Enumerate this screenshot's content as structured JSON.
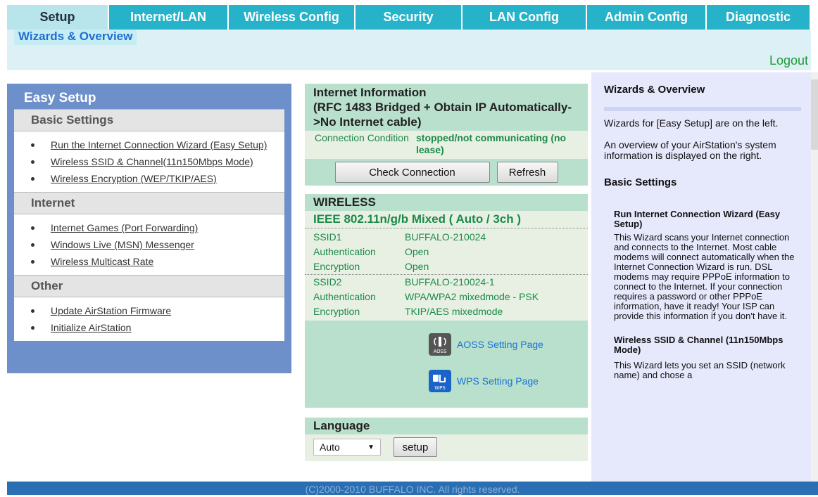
{
  "tabs": [
    "Setup",
    "Internet/LAN",
    "Wireless Config",
    "Security",
    "LAN Config",
    "Admin Config",
    "Diagnostic"
  ],
  "subtab": "Wizards & Overview",
  "logout": "Logout",
  "left": {
    "title": "Easy Setup",
    "sections": [
      {
        "name": "Basic Settings",
        "items": [
          "Run the Internet Connection Wizard (Easy Setup)",
          "Wireless SSID & Channel(11n150Mbps Mode)",
          "Wireless Encryption (WEP/TKIP/AES)"
        ]
      },
      {
        "name": "Internet",
        "items": [
          "Internet Games (Port Forwarding)",
          "Windows Live (MSN) Messenger",
          "Wireless Multicast Rate"
        ]
      },
      {
        "name": "Other",
        "items": [
          "Update AirStation Firmware",
          "Initialize AirStation"
        ]
      }
    ]
  },
  "internet": {
    "title": "Internet Information",
    "subtitle": "(RFC 1483 Bridged + Obtain IP Automatically->No Internet cable)",
    "conn_label": "Connection Condition",
    "conn_value": "stopped/not communicating (no lease)",
    "check_button": "Check Connection",
    "refresh_button": "Refresh"
  },
  "wireless": {
    "title": "WIRELESS",
    "mode": "IEEE 802.11n/g/b Mixed ( Auto / 3ch )",
    "rows": [
      {
        "k": "SSID1",
        "v": "BUFFALO-210024"
      },
      {
        "k": "Authentication",
        "v": "Open"
      },
      {
        "k": "Encryption",
        "v": "Open"
      },
      {
        "k": "SSID2",
        "v": "BUFFALO-210024-1"
      },
      {
        "k": "Authentication",
        "v": "WPA/WPA2 mixedmode - PSK"
      },
      {
        "k": "Encryption",
        "v": "TKIP/AES mixedmode"
      }
    ],
    "aoss_link": "AOSS Setting Page",
    "aoss_icon_text": "AOSS",
    "wps_link": "WPS Setting Page",
    "wps_icon_text": "WPS"
  },
  "language": {
    "title": "Language",
    "selected": "Auto",
    "setup_button": "setup"
  },
  "help": {
    "title": "Wizards & Overview",
    "intro1": "Wizards for [Easy Setup] are on the left.",
    "intro2": "An overview of your AirStation's system information is displayed on the right.",
    "basic_title": "Basic Settings",
    "item1_title": "Run Internet Connection Wizard (Easy Setup)",
    "item1_text": "This Wizard scans your Internet connection and connects to the Internet. Most cable modems will connect automatically when the Internet Connection Wizard is run. DSL modems may require PPPoE information to connect to the Internet. If your connection requires a password or other PPPoE information, have it ready! Your ISP can provide this information if you don't have it.",
    "item2_title": "Wireless SSID & Channel (11n150Mbps Mode)",
    "item2_text": "This Wizard lets you set an SSID (network name) and chose a"
  },
  "footer": "(C)2000-2010 BUFFALO INC. All rights reserved."
}
